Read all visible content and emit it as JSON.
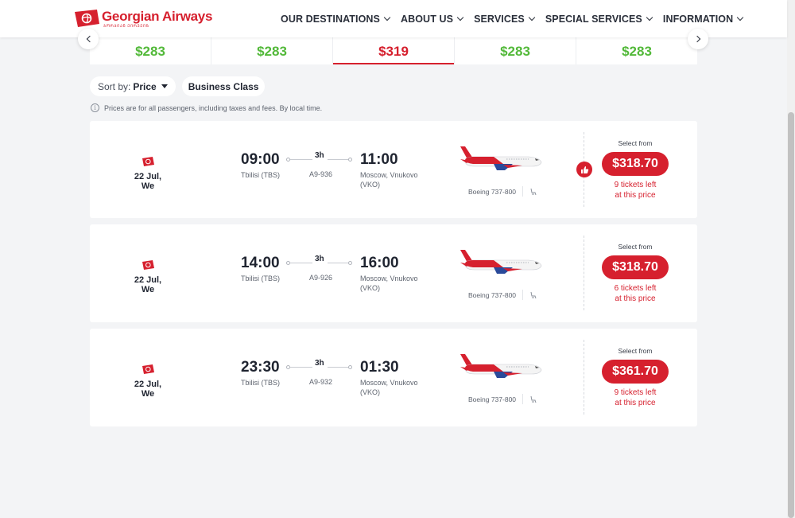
{
  "brand": {
    "name": "Georgian Airways",
    "tagline": "ᲯᲝᲠᲯᲘᲐᲜ ᲔᲘᲠᲕᲔᲘᲖ",
    "color": "#d6202e"
  },
  "nav": [
    {
      "label": "OUR DESTINATIONS"
    },
    {
      "label": "ABOUT US"
    },
    {
      "label": "SERVICES"
    },
    {
      "label": "SPECIAL SERVICES"
    },
    {
      "label": "INFORMATION"
    }
  ],
  "price_strip": [
    {
      "price": "$283",
      "active": false
    },
    {
      "price": "$283",
      "active": false
    },
    {
      "price": "$319",
      "active": true
    },
    {
      "price": "$283",
      "active": false
    },
    {
      "price": "$283",
      "active": false
    }
  ],
  "filters": {
    "sort_label": "Sort by:",
    "sort_value": "Price",
    "class_label": "Business Class"
  },
  "note": "Prices are for all passengers, including taxes and fees. By local time.",
  "flights": [
    {
      "date": "22 Jul, We",
      "dep_time": "09:00",
      "dep_city": "Tbilisi (TBS)",
      "duration": "3h",
      "flight_no": "A9-936",
      "arr_time": "11:00",
      "arr_city_1": "Moscow, Vnukovo",
      "arr_city_2": "(VKO)",
      "aircraft": "Boeing 737-800",
      "recommended": true,
      "select_from": "Select from",
      "price": "$318.70",
      "tickets_1": "9 tickets left",
      "tickets_2": "at this price"
    },
    {
      "date": "22 Jul, We",
      "dep_time": "14:00",
      "dep_city": "Tbilisi (TBS)",
      "duration": "3h",
      "flight_no": "A9-926",
      "arr_time": "16:00",
      "arr_city_1": "Moscow, Vnukovo",
      "arr_city_2": "(VKO)",
      "aircraft": "Boeing 737-800",
      "recommended": false,
      "select_from": "Select from",
      "price": "$318.70",
      "tickets_1": "6 tickets left",
      "tickets_2": "at this price"
    },
    {
      "date": "22 Jul, We",
      "dep_time": "23:30",
      "dep_city": "Tbilisi (TBS)",
      "duration": "3h",
      "flight_no": "A9-932",
      "arr_time": "01:30",
      "arr_city_1": "Moscow, Vnukovo",
      "arr_city_2": "(VKO)",
      "aircraft": "Boeing 737-800",
      "recommended": false,
      "select_from": "Select from",
      "price": "$361.70",
      "tickets_1": "9 tickets left",
      "tickets_2": "at this price"
    }
  ]
}
